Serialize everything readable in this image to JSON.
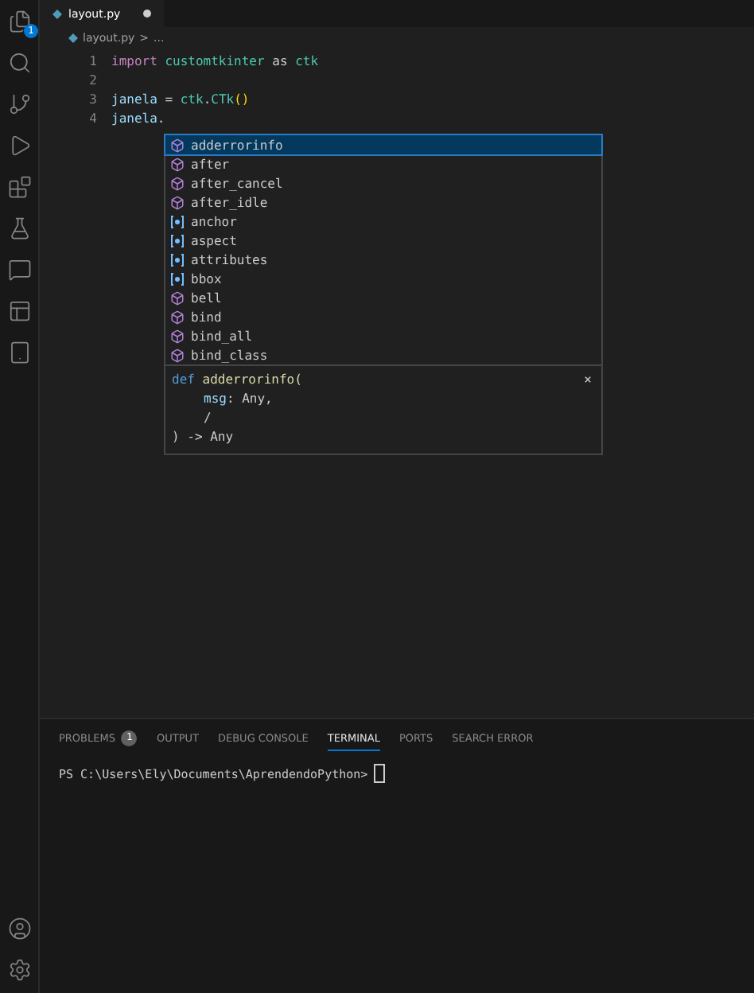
{
  "activity_bar": {
    "explorer_badge": "1"
  },
  "tabs": [
    {
      "label": "layout.py",
      "modified": true,
      "selected": true
    }
  ],
  "breadcrumb": [
    "layout.py",
    ">",
    "..."
  ],
  "editor": {
    "lines": [
      {
        "number": "1",
        "tokens": [
          {
            "kind": "keyword",
            "text": "import"
          },
          {
            "kind": "module",
            "text": "customtkinter",
            "space_before": true
          },
          {
            "kind": "plain",
            "text": " as "
          },
          {
            "kind": "module",
            "text": "ctk"
          }
        ]
      },
      {
        "number": "2"
      },
      {
        "number": "3",
        "tokens": [
          {
            "kind": "variable",
            "text": "janela"
          },
          {
            "kind": "plain",
            "text": " = "
          },
          {
            "kind": "module",
            "text": "ctk"
          },
          {
            "kind": "plain",
            "text": "."
          },
          {
            "kind": "class",
            "text": "CTk"
          },
          {
            "kind": "paren",
            "text": "()"
          }
        ]
      },
      {
        "number": "4",
        "tokens": [
          {
            "kind": "variable",
            "text": "janela"
          },
          {
            "kind": "plain",
            "text": "."
          }
        ]
      }
    ]
  },
  "suggestions": {
    "items": [
      {
        "label": "adderrorinfo",
        "kind": "method",
        "selected": true
      },
      {
        "label": "after",
        "kind": "method",
        "selected": false
      },
      {
        "label": "after_cancel",
        "kind": "method",
        "selected": false
      },
      {
        "label": "after_idle",
        "kind": "method",
        "selected": false
      },
      {
        "label": "anchor",
        "kind": "field",
        "selected": false
      },
      {
        "label": "aspect",
        "kind": "field",
        "selected": false
      },
      {
        "label": "attributes",
        "kind": "field",
        "selected": false
      },
      {
        "label": "bbox",
        "kind": "field",
        "selected": false
      },
      {
        "label": "bell",
        "kind": "method",
        "selected": false
      },
      {
        "label": "bind",
        "kind": "method",
        "selected": false
      },
      {
        "label": "bind_all",
        "kind": "method",
        "selected": false
      },
      {
        "label": "bind_class",
        "kind": "method",
        "selected": false
      }
    ],
    "detail": {
      "keyword": "def",
      "signature": "adderrorinfo(",
      "params": [
        {
          "name": "msg",
          "type": ": Any,"
        },
        {
          "type": "/"
        }
      ],
      "returns": ") -> Any",
      "close": "×"
    }
  },
  "panel": {
    "tabs": [
      {
        "label": "PROBLEMS",
        "badge": "1",
        "selected": false
      },
      {
        "label": "OUTPUT",
        "selected": false
      },
      {
        "label": "DEBUG CONSOLE",
        "selected": false
      },
      {
        "label": "TERMINAL",
        "selected": true
      },
      {
        "label": "PORTS",
        "selected": false
      },
      {
        "label": "SEARCH ERROR",
        "selected": false
      }
    ],
    "terminal_prompt": "PS C:\\Users\\Ely\\Documents\\AprendendoPython>"
  }
}
